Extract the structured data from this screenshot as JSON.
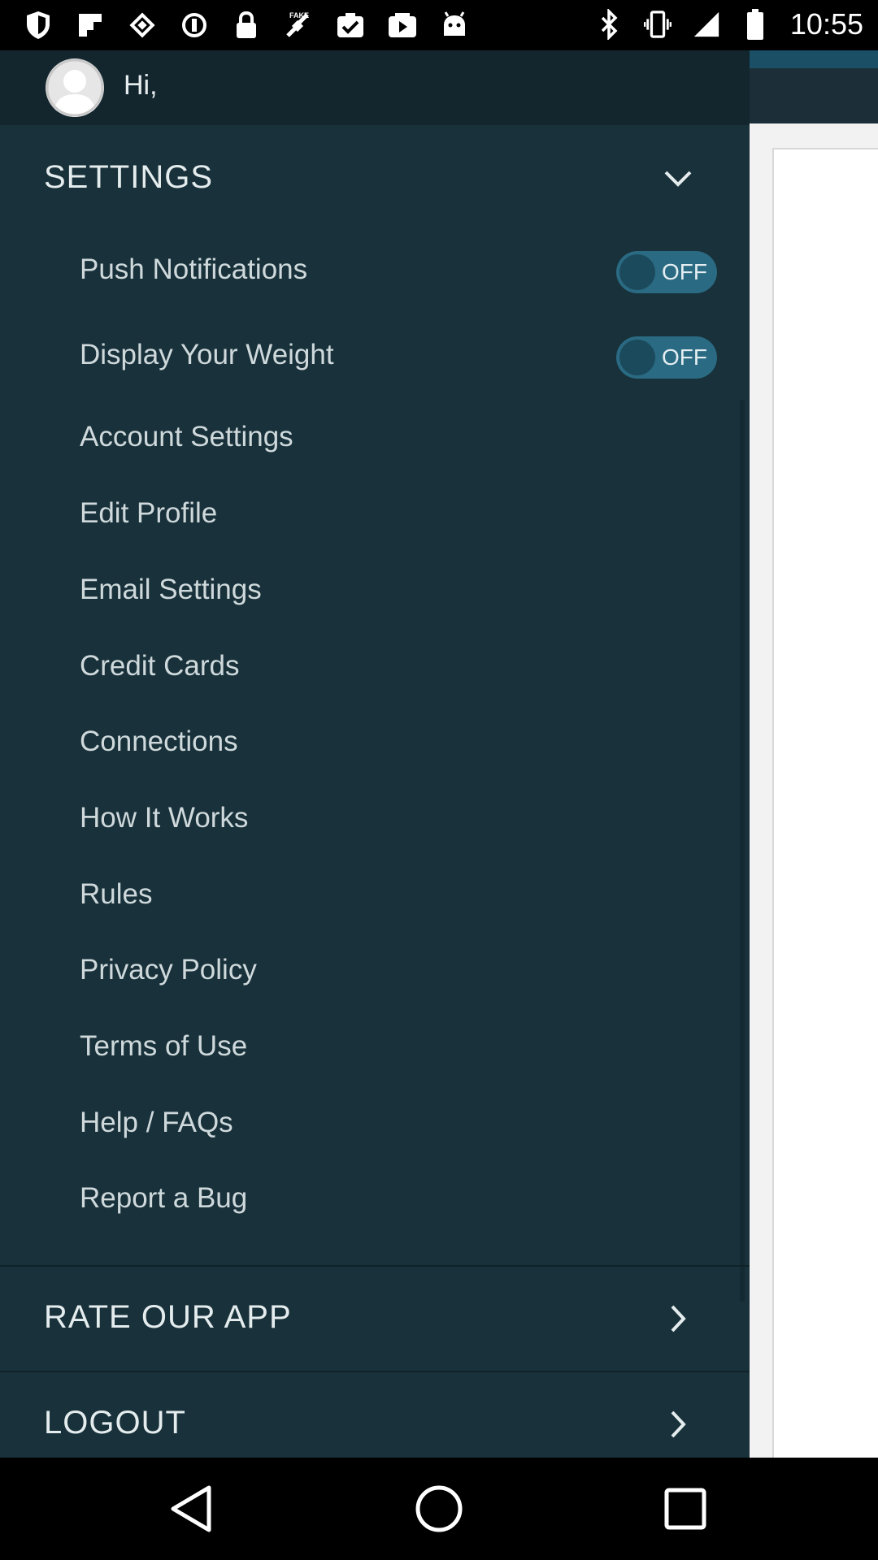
{
  "status_bar": {
    "time": "10:55",
    "left_icons": [
      "shield-icon",
      "flipboard-icon",
      "puzzle-icon",
      "sync-icon",
      "lock-icon",
      "fake-gps-icon",
      "task-check-icon",
      "youtube-icon",
      "android-icon"
    ],
    "right_icons": [
      "bluetooth-icon",
      "vibrate-icon",
      "signal-icon",
      "battery-icon"
    ]
  },
  "drawer": {
    "greeting": "Hi,",
    "settings_section": {
      "label": "SETTINGS",
      "icon": "chevron-down-icon",
      "items": [
        {
          "label": "Push Notifications",
          "toggle": "OFF"
        },
        {
          "label": "Display Your Weight",
          "toggle": "OFF"
        },
        {
          "label": "Account Settings"
        },
        {
          "label": "Edit Profile"
        },
        {
          "label": "Email Settings"
        },
        {
          "label": "Credit Cards"
        },
        {
          "label": "Connections"
        },
        {
          "label": "How It Works"
        },
        {
          "label": "Rules"
        },
        {
          "label": "Privacy Policy"
        },
        {
          "label": "Terms of Use"
        },
        {
          "label": "Help / FAQs"
        },
        {
          "label": "Report a Bug"
        }
      ]
    },
    "rate_section": {
      "label": "RATE OUR APP",
      "icon": "chevron-right-icon"
    },
    "logout_section": {
      "label": "LOGOUT",
      "icon": "chevron-right-icon"
    }
  },
  "nav_bar": {
    "icons": [
      "back-icon",
      "home-icon",
      "recents-icon"
    ]
  },
  "colors": {
    "drawer_bg": "#18313a",
    "header_bg": "#13262e",
    "toggle_bg": "#2a6a82",
    "text": "#cfd9dc"
  }
}
